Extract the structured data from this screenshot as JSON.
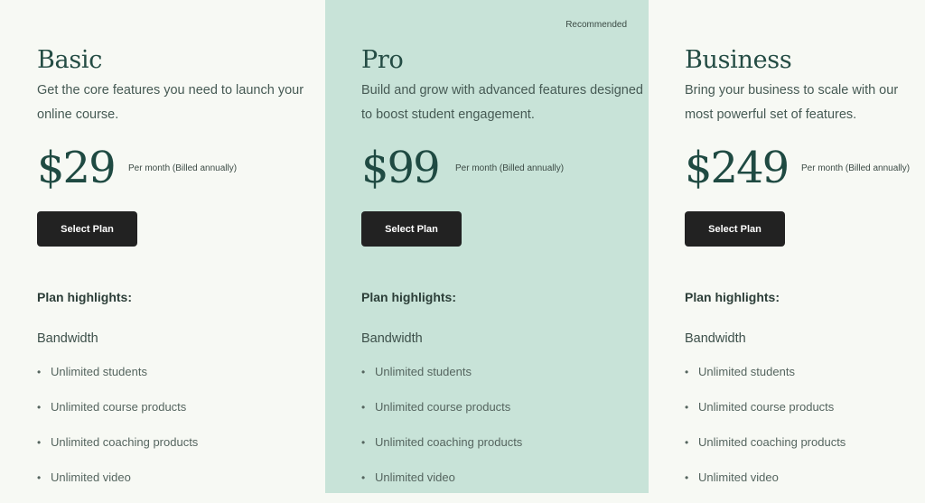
{
  "plans": [
    {
      "name": "Basic",
      "description": "Get the core features you need to launch your online course.",
      "price": "$29",
      "billing": "Per month (Billed annually)",
      "button_label": "Select Plan",
      "highlights_title": "Plan highlights:",
      "group_title": "Bandwidth",
      "features": [
        "Unlimited students",
        "Unlimited course products",
        "Unlimited coaching products",
        "Unlimited video"
      ]
    },
    {
      "name": "Pro",
      "badge": "Recommended",
      "description": "Build and grow with advanced features designed to boost student engagement.",
      "price": "$99",
      "billing": "Per month (Billed annually)",
      "button_label": "Select Plan",
      "highlights_title": "Plan highlights:",
      "group_title": "Bandwidth",
      "features": [
        "Unlimited students",
        "Unlimited course products",
        "Unlimited coaching products",
        "Unlimited video"
      ]
    },
    {
      "name": "Business",
      "description": "Bring your business to scale with our most powerful set of features.",
      "price": "$249",
      "billing": "Per month (Billed annually)",
      "button_label": "Select Plan",
      "highlights_title": "Plan highlights:",
      "group_title": "Bandwidth",
      "features": [
        "Unlimited students",
        "Unlimited course products",
        "Unlimited coaching products",
        "Unlimited video"
      ]
    }
  ],
  "colors": {
    "page_background": "#f7f9f4",
    "recommended_background": "#c8e3d8",
    "button_background": "#222222",
    "price_color": "#1f4a42"
  },
  "icons": {
    "bullet": "•"
  }
}
